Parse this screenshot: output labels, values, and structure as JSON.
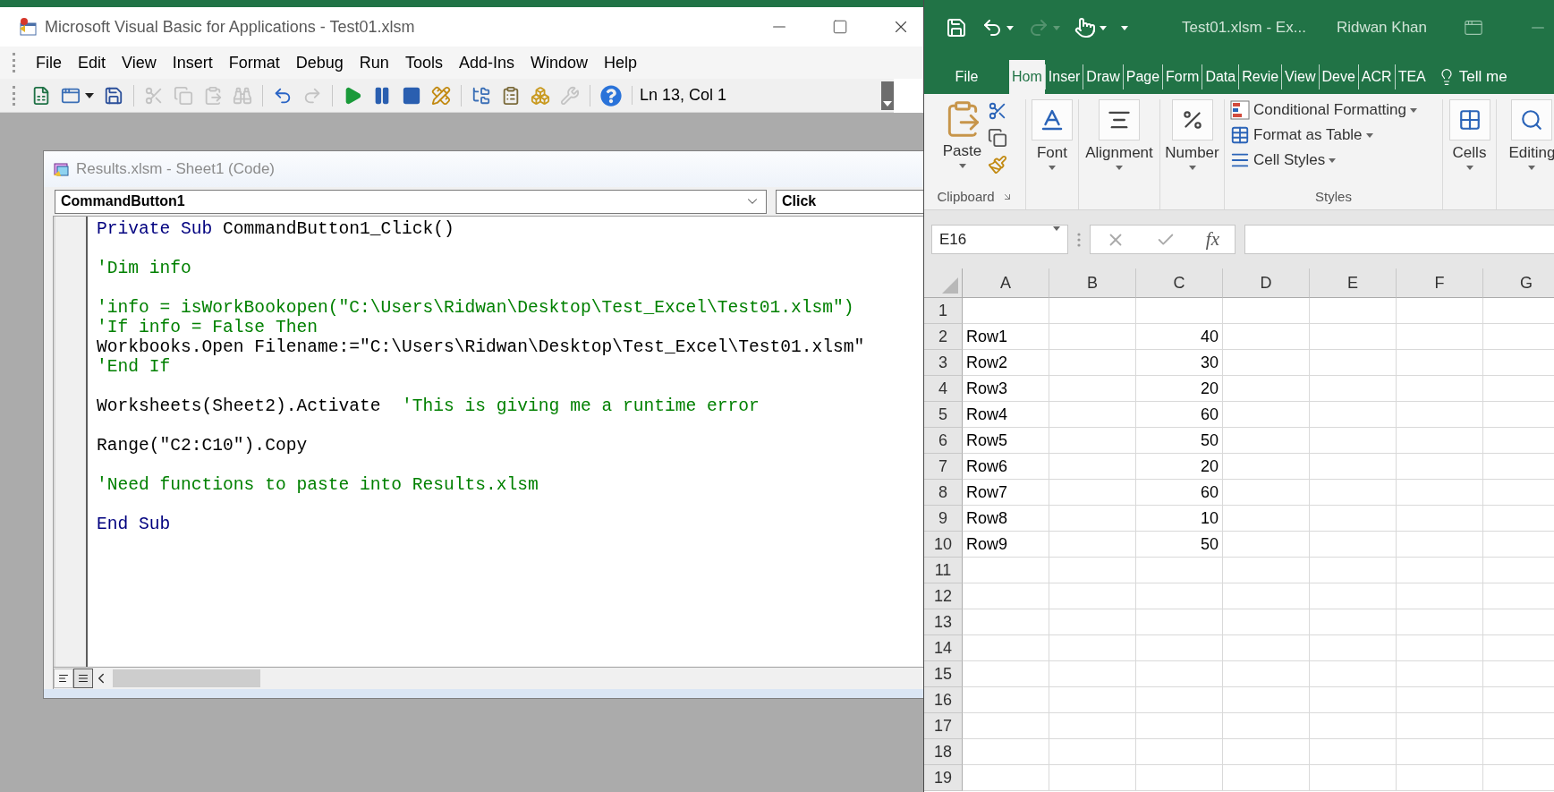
{
  "vba": {
    "title": "Microsoft Visual Basic for Applications - Test01.xlsm",
    "menu": [
      "File",
      "Edit",
      "View",
      "Insert",
      "Format",
      "Debug",
      "Run",
      "Tools",
      "Add-Ins",
      "Window",
      "Help"
    ],
    "toolbar": [
      {
        "kind": "excel",
        "disabled": false
      },
      {
        "kind": "userform",
        "disabled": false
      },
      {
        "kind": "save",
        "disabled": false
      },
      {
        "kind": "separator"
      },
      {
        "kind": "cut",
        "disabled": true
      },
      {
        "kind": "copy",
        "disabled": true
      },
      {
        "kind": "paste",
        "disabled": true
      },
      {
        "kind": "find",
        "disabled": true
      },
      {
        "kind": "separator"
      },
      {
        "kind": "undo",
        "disabled": false
      },
      {
        "kind": "redo",
        "disabled": true
      },
      {
        "kind": "separator"
      },
      {
        "kind": "run",
        "disabled": false
      },
      {
        "kind": "pause",
        "disabled": false
      },
      {
        "kind": "stop",
        "disabled": false
      },
      {
        "kind": "design",
        "disabled": false
      },
      {
        "kind": "separator"
      },
      {
        "kind": "project",
        "disabled": false
      },
      {
        "kind": "properties",
        "disabled": false
      },
      {
        "kind": "browser",
        "disabled": false
      },
      {
        "kind": "toolbox",
        "disabled": true
      },
      {
        "kind": "separator"
      },
      {
        "kind": "help",
        "disabled": false
      }
    ],
    "position": "Ln 13, Col 1",
    "code_window": {
      "title": "Results.xlsm - Sheet1 (Code)",
      "object": "CommandButton1",
      "procedure": "Click",
      "lines": [
        {
          "kind": "code",
          "tokens": [
            {
              "kind": "keyword",
              "text": "Private Sub"
            },
            {
              "kind": "plain",
              "text": " CommandButton1_Click()"
            }
          ]
        },
        {
          "kind": "blank"
        },
        {
          "kind": "code",
          "tokens": [
            {
              "kind": "comment",
              "text": "'Dim info"
            }
          ]
        },
        {
          "kind": "blank"
        },
        {
          "kind": "code",
          "tokens": [
            {
              "kind": "comment",
              "text": "'info = isWorkBookopen(\"C:\\Users\\Ridwan\\Desktop\\Test_Excel\\Test01.xlsm\")"
            }
          ]
        },
        {
          "kind": "code",
          "tokens": [
            {
              "kind": "comment",
              "text": "'If info = False Then"
            }
          ]
        },
        {
          "kind": "code",
          "tokens": [
            {
              "kind": "plain",
              "text": "Workbooks.Open Filename:=\"C:\\Users\\Ridwan\\Desktop\\Test_Excel\\Test01.xlsm\""
            }
          ]
        },
        {
          "kind": "code",
          "tokens": [
            {
              "kind": "comment",
              "text": "'End If"
            }
          ]
        },
        {
          "kind": "blank"
        },
        {
          "kind": "code",
          "tokens": [
            {
              "kind": "plain",
              "text": "Worksheets(Sheet2).Activate  "
            },
            {
              "kind": "comment",
              "text": "'This is giving me a runtime error"
            }
          ]
        },
        {
          "kind": "blank"
        },
        {
          "kind": "code",
          "tokens": [
            {
              "kind": "plain",
              "text": "Range(\"C2:C10\").Copy"
            }
          ]
        },
        {
          "kind": "blank"
        },
        {
          "kind": "code",
          "tokens": [
            {
              "kind": "comment",
              "text": "'Need functions to paste into Results.xlsm"
            }
          ]
        },
        {
          "kind": "blank"
        },
        {
          "kind": "code",
          "tokens": [
            {
              "kind": "keyword",
              "text": "End Sub"
            }
          ]
        }
      ]
    }
  },
  "excel": {
    "quick_access": [
      {
        "kind": "save",
        "disabled": false
      },
      {
        "kind": "undo",
        "disabled": false
      },
      {
        "kind": "redo",
        "disabled": true
      },
      {
        "kind": "touch",
        "disabled": false
      },
      {
        "kind": "customize",
        "disabled": false
      }
    ],
    "title": "Test01.xlsm - Ex...",
    "user": "Ridwan Khan",
    "tabs": [
      {
        "label": "File",
        "selected": false
      },
      {
        "label": "Hom",
        "selected": true
      },
      {
        "label": "Inser",
        "selected": false
      },
      {
        "label": "Draw",
        "selected": false
      },
      {
        "label": "Page",
        "selected": false
      },
      {
        "label": "Form",
        "selected": false
      },
      {
        "label": "Data",
        "selected": false
      },
      {
        "label": "Revie",
        "selected": false
      },
      {
        "label": "View",
        "selected": false
      },
      {
        "label": "Deve",
        "selected": false
      },
      {
        "label": "ACR",
        "selected": false
      },
      {
        "label": "TEA",
        "selected": false
      }
    ],
    "tell_me": "Tell me",
    "ribbon": [
      {
        "kind": "clipboard",
        "button": "Paste",
        "label": "Clipboard"
      },
      {
        "kind": "font",
        "button": "Font"
      },
      {
        "kind": "alignment",
        "button": "Alignment"
      },
      {
        "kind": "number",
        "button": "Number"
      },
      {
        "kind": "styles",
        "commands": [
          "Conditional Formatting",
          "Format as Table",
          "Cell Styles"
        ],
        "label": "Styles"
      },
      {
        "kind": "cells",
        "button": "Cells"
      },
      {
        "kind": "editing",
        "button": "Editing"
      }
    ],
    "name_box": "E16",
    "function_label": "fx",
    "columns": [
      "A",
      "B",
      "C",
      "D",
      "E",
      "F",
      "G"
    ],
    "rows": [
      {
        "number": "1"
      },
      {
        "number": "2",
        "a": "Row1",
        "c": "40"
      },
      {
        "number": "3",
        "a": "Row2",
        "c": "30"
      },
      {
        "number": "4",
        "a": "Row3",
        "c": "20"
      },
      {
        "number": "5",
        "a": "Row4",
        "c": "60"
      },
      {
        "number": "6",
        "a": "Row5",
        "c": "50"
      },
      {
        "number": "7",
        "a": "Row6",
        "c": "20"
      },
      {
        "number": "8",
        "a": "Row7",
        "c": "60"
      },
      {
        "number": "9",
        "a": "Row8",
        "c": "10"
      },
      {
        "number": "10",
        "a": "Row9",
        "c": "50"
      },
      {
        "number": "11"
      },
      {
        "number": "12"
      },
      {
        "number": "13"
      },
      {
        "number": "14"
      },
      {
        "number": "15"
      },
      {
        "number": "16"
      },
      {
        "number": "17"
      },
      {
        "number": "18"
      },
      {
        "number": "19"
      }
    ]
  }
}
